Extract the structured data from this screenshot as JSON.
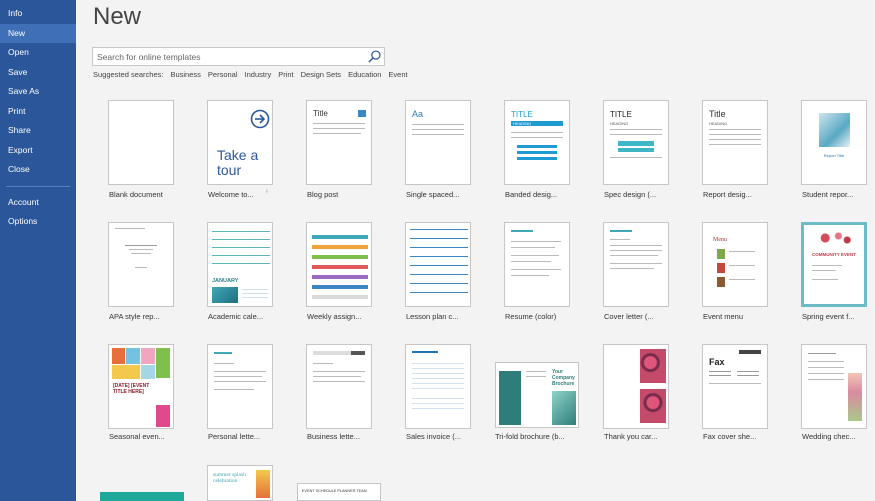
{
  "sidebar": {
    "items": [
      {
        "label": "Info"
      },
      {
        "label": "New",
        "active": true
      },
      {
        "label": "Open"
      },
      {
        "label": "Save"
      },
      {
        "label": "Save As"
      },
      {
        "label": "Print"
      },
      {
        "label": "Share"
      },
      {
        "label": "Export"
      },
      {
        "label": "Close"
      }
    ],
    "bottom_items": [
      {
        "label": "Account"
      },
      {
        "label": "Options"
      }
    ]
  },
  "header": {
    "title": "New"
  },
  "search": {
    "placeholder": "Search for online templates"
  },
  "suggested": {
    "label": "Suggested searches:",
    "links": [
      "Business",
      "Personal",
      "Industry",
      "Print",
      "Design Sets",
      "Education",
      "Event"
    ]
  },
  "templates": [
    {
      "caption": "Blank document"
    },
    {
      "caption": "Welcome to...",
      "title_text": "Take a tour"
    },
    {
      "caption": "Blog post",
      "title_text": "Title"
    },
    {
      "caption": "Single spaced...",
      "title_text": "Aa"
    },
    {
      "caption": "Banded desig...",
      "title_text": "TITLE",
      "sub_text": "HEADING"
    },
    {
      "caption": "Spec design (...",
      "title_text": "TITLE",
      "sub_text": "HEADING"
    },
    {
      "caption": "Report desig...",
      "title_text": "Title",
      "sub_text": "HEADING"
    },
    {
      "caption": "Student repor...",
      "title_text": "Report Title"
    },
    {
      "caption": "APA style rep..."
    },
    {
      "caption": "Academic cale...",
      "title_text": "JANUARY"
    },
    {
      "caption": "Weekly assign..."
    },
    {
      "caption": "Lesson plan c..."
    },
    {
      "caption": "Resume (color)"
    },
    {
      "caption": "Cover letter (..."
    },
    {
      "caption": "Event menu",
      "title_text": "Menu"
    },
    {
      "caption": "Spring event f...",
      "title_text": "COMMUNITY EVENT"
    },
    {
      "caption": "Seasonal even...",
      "title_text": "[DATE] [EVENT TITLE HERE]"
    },
    {
      "caption": "Personal lette..."
    },
    {
      "caption": "Business lette..."
    },
    {
      "caption": "Sales invoice (..."
    },
    {
      "caption": "Tri-fold brochure (b...",
      "title_text": "Your Company Brochure"
    },
    {
      "caption": "Thank you car..."
    },
    {
      "caption": "Fax cover she...",
      "title_text": "Fax"
    },
    {
      "caption": "Wedding chec..."
    },
    {
      "caption": "",
      "title_text": "summer splash celebration"
    },
    {
      "caption": "",
      "title_text": "EVENT SCHEDULE PLANNER TEAM"
    }
  ],
  "colors": {
    "sidebar": "#2b579a",
    "sidebar_active": "#3f6fb6",
    "accent_teal": "#3fa7b5",
    "accent_blue": "#1f75b7"
  }
}
